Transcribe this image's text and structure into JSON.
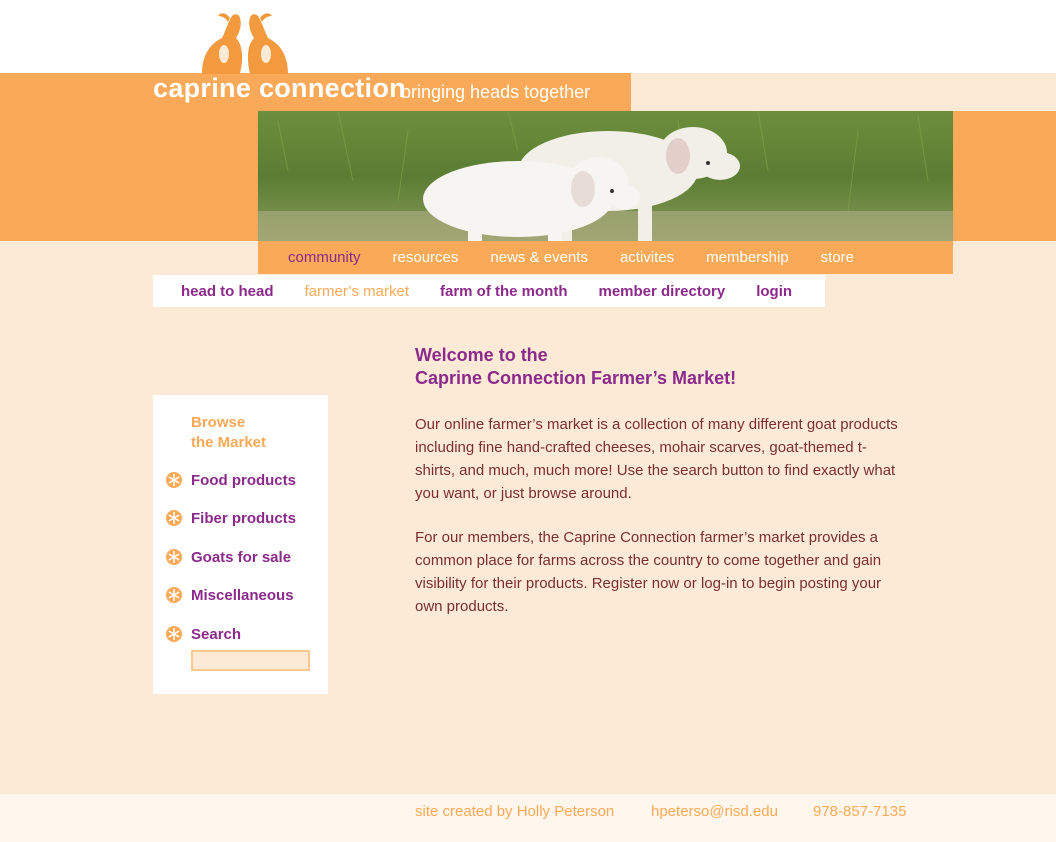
{
  "header": {
    "site_title": "caprine connection",
    "tagline": "bringing heads together",
    "logo_icon": "goats-logo-icon",
    "hero_image": "goats-in-grass-photo"
  },
  "main_nav": {
    "items": [
      {
        "label": "community",
        "active": true
      },
      {
        "label": "resources"
      },
      {
        "label": "news & events"
      },
      {
        "label": "activites"
      },
      {
        "label": "membership"
      },
      {
        "label": "store"
      }
    ]
  },
  "sub_nav": {
    "items": [
      {
        "label": "head to head"
      },
      {
        "label": "farmer’s market",
        "active": true
      },
      {
        "label": "farm of the month"
      },
      {
        "label": "member directory"
      },
      {
        "label": "login"
      }
    ]
  },
  "sidebar": {
    "heading_line1": "Browse",
    "heading_line2": "the Market",
    "items": [
      {
        "label": "Food products",
        "icon": "asterisk-bullet-icon"
      },
      {
        "label": "Fiber products",
        "icon": "asterisk-bullet-icon"
      },
      {
        "label": "Goats for sale",
        "icon": "asterisk-bullet-icon"
      },
      {
        "label": "Miscellaneous",
        "icon": "asterisk-bullet-icon"
      },
      {
        "label": "Search",
        "icon": "asterisk-bullet-icon"
      }
    ],
    "search_value": ""
  },
  "main": {
    "welcome_line1": "Welcome to the",
    "welcome_line2": "Caprine Connection Farmer’s Market!",
    "paragraph1": "Our online farmer’s market is a collection of many different goat products including fine hand-crafted cheeses, mohair scarves, goat-themed t-shirts, and much, much more! Use the search button to find exactly what you want, or just browse around.",
    "paragraph2": "For our members, the Caprine Connection farmer’s market provides a common place for farms across the country to come together and gain visibility for their products. Register now or log-in to begin posting your own products."
  },
  "footer": {
    "credit": "site created by Holly Peterson",
    "email": "hpeterso@risd.edu",
    "phone": "978-857-7135"
  },
  "colors": {
    "orange": "#f9a957",
    "cream": "#fdead6",
    "purple": "#8b2a8b",
    "body_text": "#7a2f2f"
  }
}
